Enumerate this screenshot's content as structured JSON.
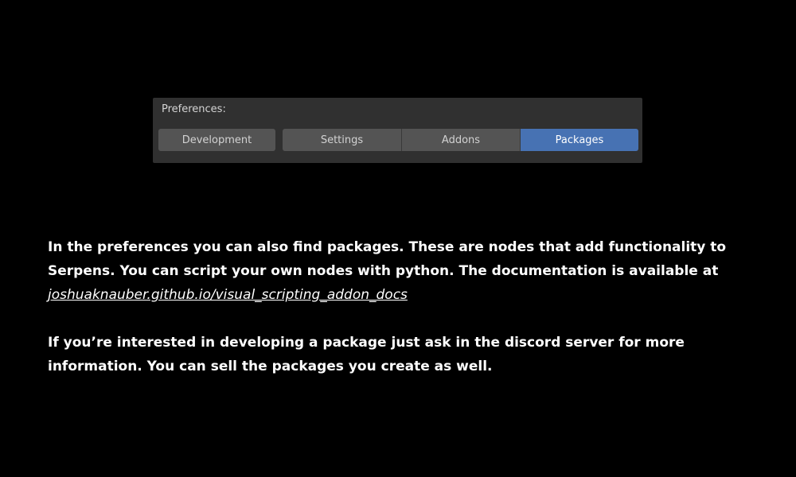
{
  "preferences": {
    "label": "Preferences:",
    "tabs": [
      {
        "label": "Development"
      },
      {
        "label": "Settings"
      },
      {
        "label": "Addons"
      },
      {
        "label": "Packages"
      }
    ],
    "active_tab": "Packages",
    "active_color": "#4772b3"
  },
  "content": {
    "paragraph1_text": "In the preferences you can also find packages. These are nodes that add functionality to Serpens. You can script your own nodes with python. The documentation is available at ",
    "paragraph1_link": "joshuaknauber.github.io/visual_scripting_addon_docs",
    "paragraph2_text": "If you’re interested in developing a package just ask in the discord server for more information. You can sell the packages you create as well."
  }
}
